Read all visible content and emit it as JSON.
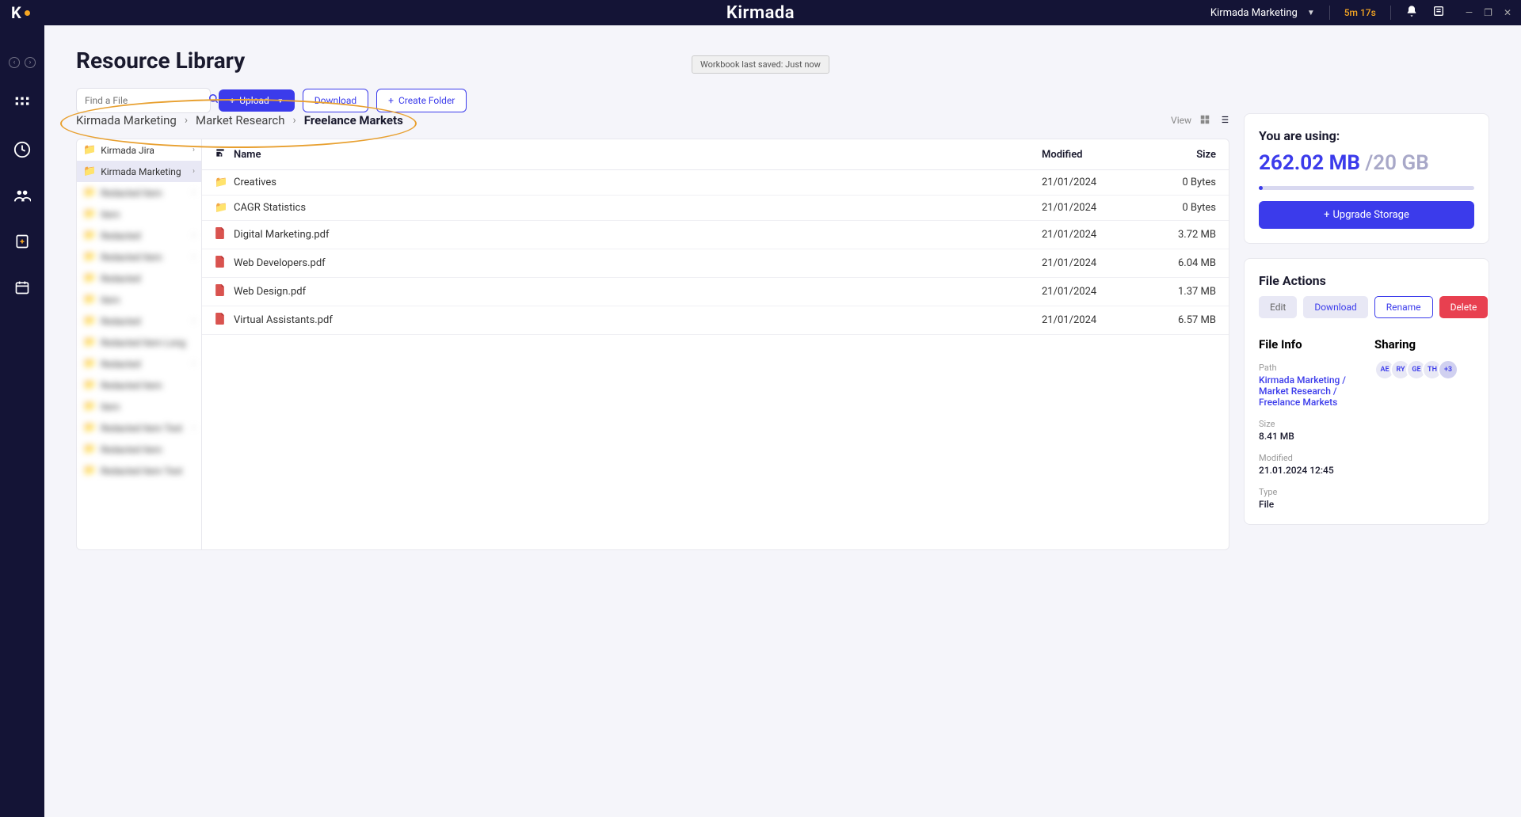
{
  "topbar": {
    "brand": "Kirmada",
    "workspace": "Kirmada Marketing",
    "timer": "5m 17s"
  },
  "page": {
    "title": "Resource Library",
    "save_status": "Workbook last saved: Just now"
  },
  "toolbar": {
    "search_placeholder": "Find a File",
    "upload": "Upload",
    "download": "Download",
    "create_folder": "Create Folder"
  },
  "breadcrumb": {
    "items": [
      "Kirmada Marketing",
      "Market Research",
      "Freelance Markets"
    ]
  },
  "view_label": "View",
  "tree": {
    "items": [
      {
        "label": "Kirmada Jira",
        "active": false
      },
      {
        "label": "Kirmada Marketing",
        "active": true
      }
    ]
  },
  "table": {
    "headers": {
      "name": "Name",
      "modified": "Modified",
      "size": "Size"
    },
    "rows": [
      {
        "type": "folder",
        "name": "Creatives",
        "modified": "21/01/2024",
        "size": "0 Bytes"
      },
      {
        "type": "folder",
        "name": "CAGR Statistics",
        "modified": "21/01/2024",
        "size": "0 Bytes"
      },
      {
        "type": "pdf",
        "name": "Digital Marketing.pdf",
        "modified": "21/01/2024",
        "size": "3.72 MB"
      },
      {
        "type": "pdf",
        "name": "Web Developers.pdf",
        "modified": "21/01/2024",
        "size": "6.04 MB"
      },
      {
        "type": "pdf",
        "name": "Web Design.pdf",
        "modified": "21/01/2024",
        "size": "1.37 MB"
      },
      {
        "type": "pdf",
        "name": "Virtual Assistants.pdf",
        "modified": "21/01/2024",
        "size": "6.57 MB"
      }
    ]
  },
  "storage": {
    "title": "You are using:",
    "used": "262.02 MB",
    "total": "/20 GB",
    "upgrade": "Upgrade Storage"
  },
  "file_actions": {
    "title": "File Actions",
    "edit": "Edit",
    "download": "Download",
    "rename": "Rename",
    "delete": "Delete"
  },
  "file_info": {
    "title": "File Info",
    "path_label": "Path",
    "path": "Kirmada Marketing / Market Research / Freelance Markets",
    "size_label": "Size",
    "size": "8.41 MB",
    "modified_label": "Modified",
    "modified": "21.01.2024 12:45",
    "type_label": "Type",
    "type": "File"
  },
  "sharing": {
    "title": "Sharing",
    "avatars": [
      "AE",
      "RY",
      "GE",
      "TH"
    ],
    "more": "+3"
  }
}
